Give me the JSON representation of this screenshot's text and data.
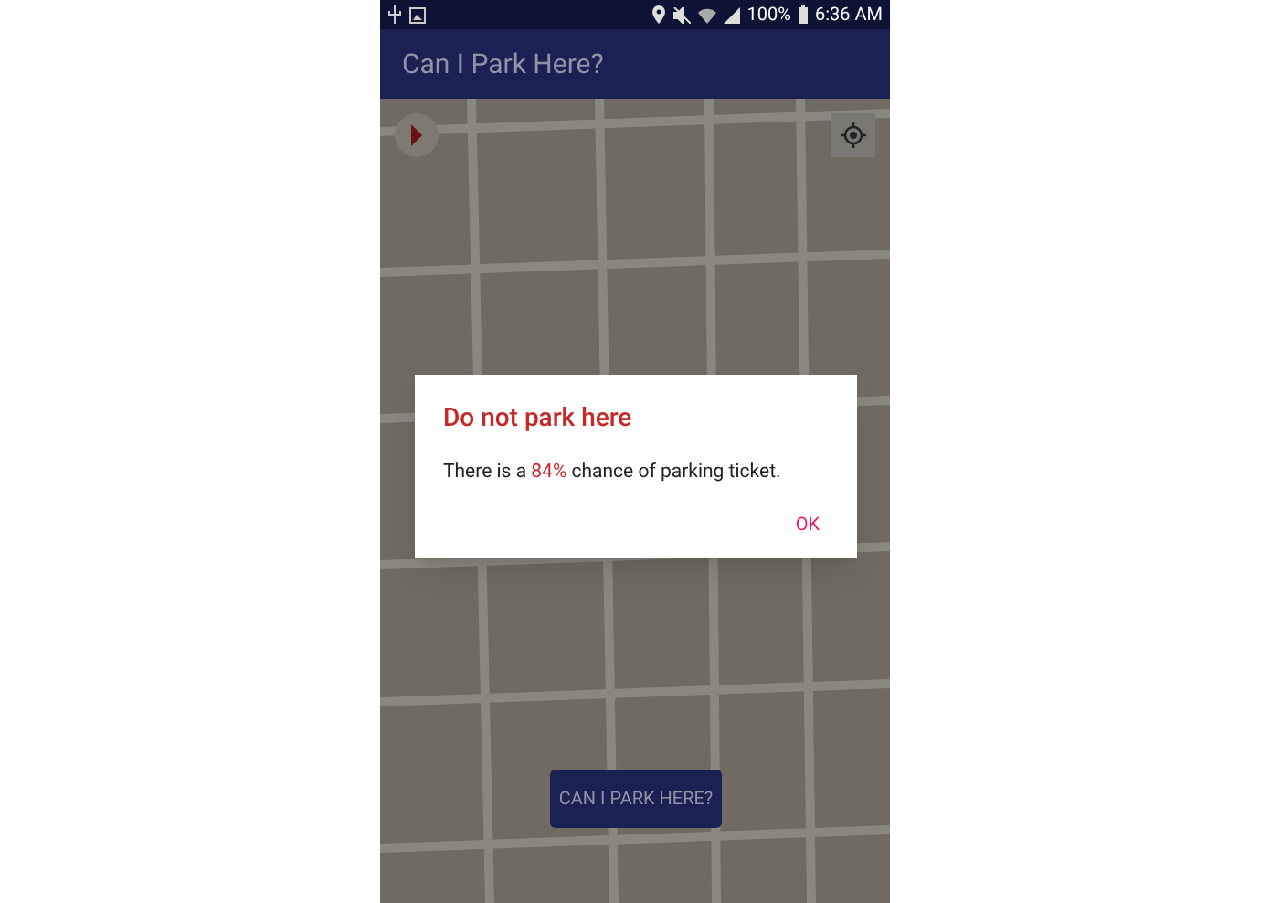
{
  "status_bar": {
    "battery": "100%",
    "time": "6:36 AM"
  },
  "app_bar": {
    "title": "Can I Park Here?"
  },
  "dialog": {
    "title": "Do not park here",
    "message": {
      "before": "There is a ",
      "highlight": "84%",
      "after": " chance of parking ticket."
    },
    "button": "OK"
  },
  "main_button": "CAN I PARK HERE?"
}
